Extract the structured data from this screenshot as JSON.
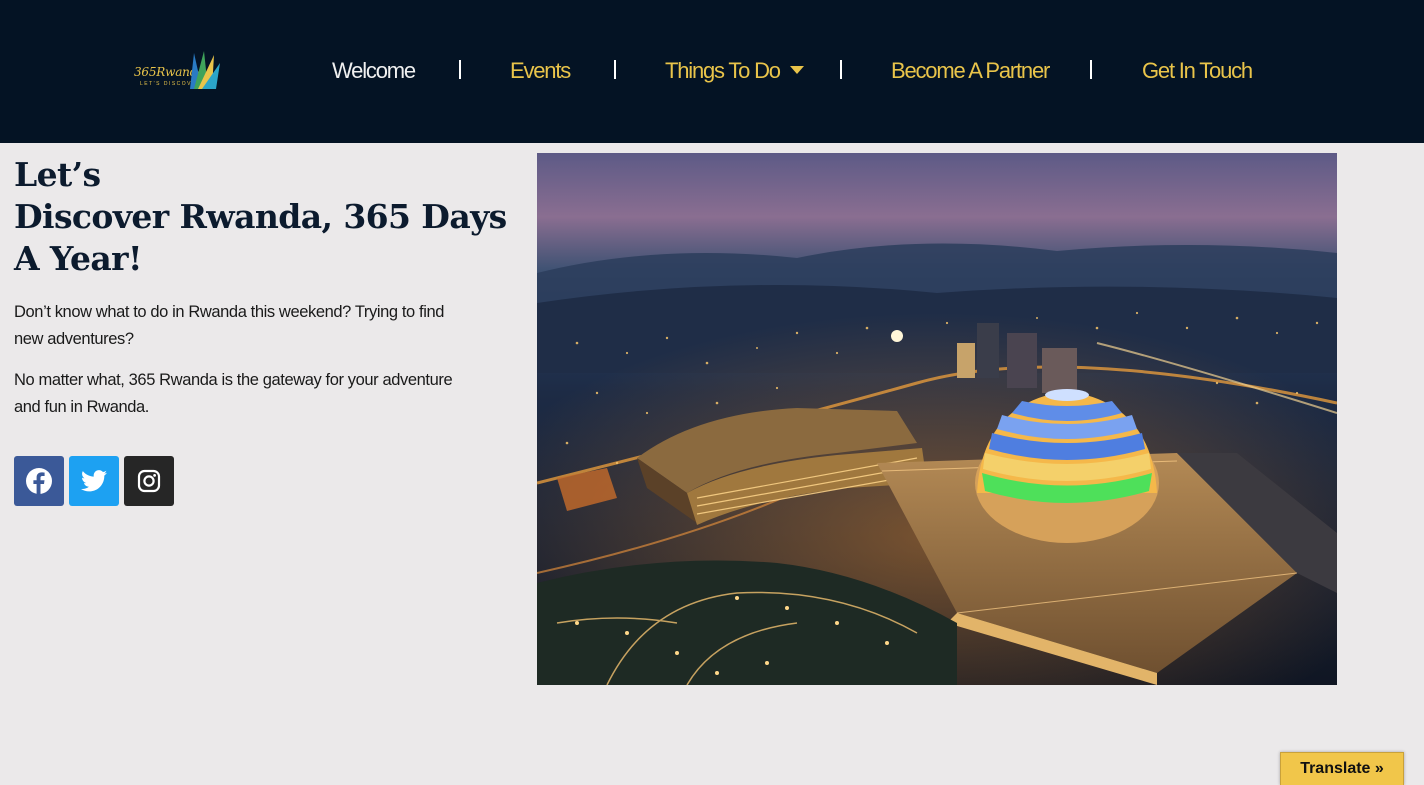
{
  "header": {
    "logo_text": "365Rwanda",
    "logo_tagline": "LET'S DISCOVER",
    "nav": [
      {
        "label": "Welcome",
        "active": true
      },
      {
        "label": "Events",
        "active": false
      },
      {
        "label": "Things To Do",
        "active": false,
        "has_dropdown": true
      },
      {
        "label": "Become A Partner",
        "active": false
      },
      {
        "label": "Get In Touch",
        "active": false
      }
    ]
  },
  "hero": {
    "title_line1": "Let’s",
    "title_line2": "Discover Rwanda, 365 Days",
    "title_line3": "A Year!",
    "paragraph1": "Don’t know what to do in Rwanda this weekend?  Trying to find new adventures?",
    "paragraph2": "No matter what, 365 Rwanda is the gateway for your adventure and fun in Rwanda.",
    "social": [
      {
        "name": "facebook",
        "icon": "facebook-icon",
        "color": "#3b5998"
      },
      {
        "name": "twitter",
        "icon": "twitter-icon",
        "color": "#1da1f2"
      },
      {
        "name": "instagram",
        "icon": "instagram-icon",
        "color": "#262626"
      }
    ]
  },
  "translate_label": "Translate »",
  "colors": {
    "header_bg": "#041324",
    "nav_gold": "#e9c44a",
    "page_bg": "#ebe9ea",
    "translate_bg": "#f1c64a"
  }
}
